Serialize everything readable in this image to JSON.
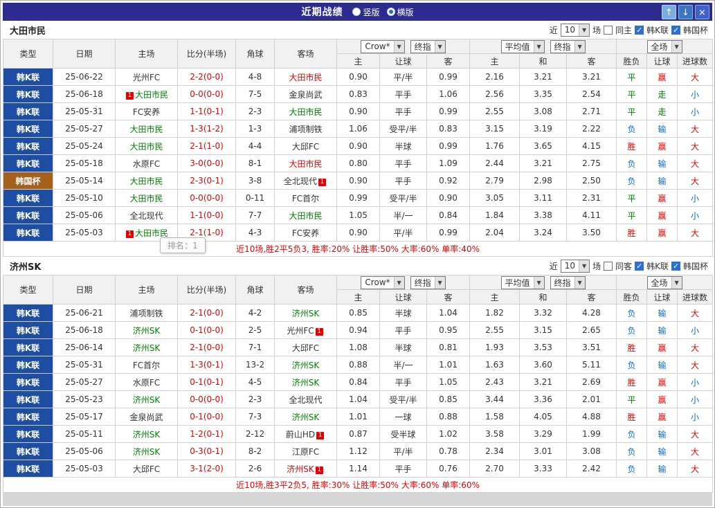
{
  "titlebar": {
    "title": "近期战绩",
    "radios": [
      {
        "label": "竖版",
        "selected": false
      },
      {
        "label": "横版",
        "selected": true
      }
    ],
    "buttons": {
      "up": "↑",
      "down": "↓",
      "close": "×"
    }
  },
  "tooltip": "排名：1",
  "tables": [
    {
      "team": "大田市民",
      "filter": {
        "near": "近",
        "count": "10",
        "games": "场",
        "same": "同主",
        "same_checked": false,
        "league": "韩K联",
        "league_checked": true,
        "cup": "韩国杯",
        "cup_checked": true
      },
      "selects": {
        "book": "Crow*",
        "book_final": "终指",
        "avg": "平均值",
        "avg_final": "终指",
        "scope": "全场"
      },
      "columns": [
        "类型",
        "日期",
        "主场",
        "比分(半场)",
        "角球",
        "客场",
        "主",
        "让球",
        "客",
        "主",
        "和",
        "客",
        "胜负",
        "让球",
        "进球数"
      ],
      "rows": [
        {
          "type": "韩K联",
          "cup": false,
          "date": "25-06-22",
          "home": "光州FC",
          "home_color": "black",
          "home_badge": "",
          "score": "2-2(0-0)",
          "corner": "4-8",
          "away": "大田市民",
          "away_color": "red",
          "away_badge": "",
          "o1": "0.90",
          "hcap": "平/半",
          "o3": "0.99",
          "a1": "2.16",
          "a2": "3.21",
          "a3": "3.21",
          "wl": "平",
          "wlc": "green",
          "hr": "赢",
          "hrc": "red",
          "ou": "大",
          "ouc": "red"
        },
        {
          "type": "韩K联",
          "cup": false,
          "date": "25-06-18",
          "home": "大田市民",
          "home_color": "green",
          "home_badge": "1",
          "score": "0-0(0-0)",
          "corner": "7-5",
          "away": "金泉尚武",
          "away_color": "black",
          "away_badge": "",
          "o1": "0.83",
          "hcap": "平手",
          "o3": "1.06",
          "a1": "2.56",
          "a2": "3.35",
          "a3": "2.54",
          "wl": "平",
          "wlc": "green",
          "hr": "走",
          "hrc": "green",
          "ou": "小",
          "ouc": "blue"
        },
        {
          "type": "韩K联",
          "cup": false,
          "date": "25-05-31",
          "home": "FC安养",
          "home_color": "black",
          "home_badge": "",
          "score": "1-1(0-1)",
          "corner": "2-3",
          "away": "大田市民",
          "away_color": "green",
          "away_badge": "",
          "o1": "0.90",
          "hcap": "平手",
          "o3": "0.99",
          "a1": "2.55",
          "a2": "3.08",
          "a3": "2.71",
          "wl": "平",
          "wlc": "green",
          "hr": "走",
          "hrc": "green",
          "ou": "小",
          "ouc": "blue"
        },
        {
          "type": "韩K联",
          "cup": false,
          "date": "25-05-27",
          "home": "大田市民",
          "home_color": "green",
          "home_badge": "",
          "score": "1-3(1-2)",
          "corner": "1-3",
          "away": "浦项制铁",
          "away_color": "black",
          "away_badge": "",
          "o1": "1.06",
          "hcap": "受平/半",
          "o3": "0.83",
          "a1": "3.15",
          "a2": "3.19",
          "a3": "2.22",
          "wl": "负",
          "wlc": "blue",
          "hr": "输",
          "hrc": "blue",
          "ou": "大",
          "ouc": "red"
        },
        {
          "type": "韩K联",
          "cup": false,
          "date": "25-05-24",
          "home": "大田市民",
          "home_color": "green",
          "home_badge": "",
          "score": "2-1(1-0)",
          "corner": "4-4",
          "away": "大邱FC",
          "away_color": "black",
          "away_badge": "",
          "o1": "0.90",
          "hcap": "半球",
          "o3": "0.99",
          "a1": "1.76",
          "a2": "3.65",
          "a3": "4.15",
          "wl": "胜",
          "wlc": "red",
          "hr": "赢",
          "hrc": "red",
          "ou": "大",
          "ouc": "red"
        },
        {
          "type": "韩K联",
          "cup": false,
          "date": "25-05-18",
          "home": "水原FC",
          "home_color": "black",
          "home_badge": "",
          "score": "3-0(0-0)",
          "corner": "8-1",
          "away": "大田市民",
          "away_color": "red",
          "away_badge": "",
          "o1": "0.80",
          "hcap": "平手",
          "o3": "1.09",
          "a1": "2.44",
          "a2": "3.21",
          "a3": "2.75",
          "wl": "负",
          "wlc": "blue",
          "hr": "输",
          "hrc": "blue",
          "ou": "大",
          "ouc": "red"
        },
        {
          "type": "韩国杯",
          "cup": true,
          "date": "25-05-14",
          "home": "大田市民",
          "home_color": "green",
          "home_badge": "",
          "score": "2-3(0-1)",
          "corner": "3-8",
          "away": "全北现代",
          "away_color": "black",
          "away_badge": "1",
          "o1": "0.90",
          "hcap": "平手",
          "o3": "0.92",
          "a1": "2.79",
          "a2": "2.98",
          "a3": "2.50",
          "wl": "负",
          "wlc": "blue",
          "hr": "输",
          "hrc": "blue",
          "ou": "大",
          "ouc": "red"
        },
        {
          "type": "韩K联",
          "cup": false,
          "date": "25-05-10",
          "home": "大田市民",
          "home_color": "green",
          "home_badge": "",
          "score": "0-0(0-0)",
          "corner": "0-11",
          "away": "FC首尔",
          "away_color": "black",
          "away_badge": "",
          "o1": "0.99",
          "hcap": "受平/半",
          "o3": "0.90",
          "a1": "3.05",
          "a2": "3.11",
          "a3": "2.31",
          "wl": "平",
          "wlc": "green",
          "hr": "赢",
          "hrc": "red",
          "ou": "小",
          "ouc": "blue"
        },
        {
          "type": "韩K联",
          "cup": false,
          "date": "25-05-06",
          "home": "全北现代",
          "home_color": "black",
          "home_badge": "",
          "score": "1-1(0-0)",
          "corner": "7-7",
          "away": "大田市民",
          "away_color": "green",
          "away_badge": "",
          "o1": "1.05",
          "hcap": "半/一",
          "o3": "0.84",
          "a1": "1.84",
          "a2": "3.38",
          "a3": "4.11",
          "wl": "平",
          "wlc": "green",
          "hr": "赢",
          "hrc": "red",
          "ou": "小",
          "ouc": "blue"
        },
        {
          "type": "韩K联",
          "cup": false,
          "date": "25-05-03",
          "home": "大田市民",
          "home_color": "green",
          "home_badge": "1",
          "score": "2-1(1-0)",
          "corner": "4-3",
          "away": "FC安养",
          "away_color": "black",
          "away_badge": "",
          "o1": "0.90",
          "hcap": "平/半",
          "o3": "0.99",
          "a1": "2.04",
          "a2": "3.24",
          "a3": "3.50",
          "wl": "胜",
          "wlc": "red",
          "hr": "赢",
          "hrc": "red",
          "ou": "大",
          "ouc": "red"
        }
      ],
      "summary": "近10场,胜2平5负3, 胜率:20% 让胜率:50% 大率:60% 单率:40%"
    },
    {
      "team": "济州SK",
      "filter": {
        "near": "近",
        "count": "10",
        "games": "场",
        "same": "同客",
        "same_checked": false,
        "league": "韩K联",
        "league_checked": true,
        "cup": "韩国杯",
        "cup_checked": true
      },
      "selects": {
        "book": "Crow*",
        "book_final": "终指",
        "avg": "平均值",
        "avg_final": "终指",
        "scope": "全场"
      },
      "columns": [
        "类型",
        "日期",
        "主场",
        "比分(半场)",
        "角球",
        "客场",
        "主",
        "让球",
        "客",
        "主",
        "和",
        "客",
        "胜负",
        "让球",
        "进球数"
      ],
      "rows": [
        {
          "type": "韩K联",
          "cup": false,
          "date": "25-06-21",
          "home": "浦项制铁",
          "home_color": "black",
          "home_badge": "",
          "score": "2-1(0-0)",
          "corner": "4-2",
          "away": "济州SK",
          "away_color": "green",
          "away_badge": "",
          "o1": "0.85",
          "hcap": "半球",
          "o3": "1.04",
          "a1": "1.82",
          "a2": "3.32",
          "a3": "4.28",
          "wl": "负",
          "wlc": "blue",
          "hr": "输",
          "hrc": "blue",
          "ou": "大",
          "ouc": "red"
        },
        {
          "type": "韩K联",
          "cup": false,
          "date": "25-06-18",
          "home": "济州SK",
          "home_color": "green",
          "home_badge": "",
          "score": "0-1(0-0)",
          "corner": "2-5",
          "away": "光州FC",
          "away_color": "black",
          "away_badge": "1",
          "o1": "0.94",
          "hcap": "平手",
          "o3": "0.95",
          "a1": "2.55",
          "a2": "3.15",
          "a3": "2.65",
          "wl": "负",
          "wlc": "blue",
          "hr": "输",
          "hrc": "blue",
          "ou": "小",
          "ouc": "blue"
        },
        {
          "type": "韩K联",
          "cup": false,
          "date": "25-06-14",
          "home": "济州SK",
          "home_color": "green",
          "home_badge": "",
          "score": "2-1(0-0)",
          "corner": "7-1",
          "away": "大邱FC",
          "away_color": "black",
          "away_badge": "",
          "o1": "1.08",
          "hcap": "半球",
          "o3": "0.81",
          "a1": "1.93",
          "a2": "3.53",
          "a3": "3.51",
          "wl": "胜",
          "wlc": "red",
          "hr": "赢",
          "hrc": "red",
          "ou": "大",
          "ouc": "red"
        },
        {
          "type": "韩K联",
          "cup": false,
          "date": "25-05-31",
          "home": "FC首尔",
          "home_color": "black",
          "home_badge": "",
          "score": "1-3(0-1)",
          "corner": "13-2",
          "away": "济州SK",
          "away_color": "green",
          "away_badge": "",
          "o1": "0.88",
          "hcap": "半/一",
          "o3": "1.01",
          "a1": "1.63",
          "a2": "3.60",
          "a3": "5.11",
          "wl": "负",
          "wlc": "blue",
          "hr": "输",
          "hrc": "blue",
          "ou": "大",
          "ouc": "red"
        },
        {
          "type": "韩K联",
          "cup": false,
          "date": "25-05-27",
          "home": "水原FC",
          "home_color": "black",
          "home_badge": "",
          "score": "0-1(0-1)",
          "corner": "4-5",
          "away": "济州SK",
          "away_color": "green",
          "away_badge": "",
          "o1": "0.84",
          "hcap": "平手",
          "o3": "1.05",
          "a1": "2.43",
          "a2": "3.21",
          "a3": "2.69",
          "wl": "胜",
          "wlc": "red",
          "hr": "赢",
          "hrc": "red",
          "ou": "小",
          "ouc": "blue"
        },
        {
          "type": "韩K联",
          "cup": false,
          "date": "25-05-23",
          "home": "济州SK",
          "home_color": "green",
          "home_badge": "",
          "score": "0-0(0-0)",
          "corner": "2-3",
          "away": "全北现代",
          "away_color": "black",
          "away_badge": "",
          "o1": "1.04",
          "hcap": "受平/半",
          "o3": "0.85",
          "a1": "3.44",
          "a2": "3.36",
          "a3": "2.01",
          "wl": "平",
          "wlc": "green",
          "hr": "赢",
          "hrc": "red",
          "ou": "小",
          "ouc": "blue"
        },
        {
          "type": "韩K联",
          "cup": false,
          "date": "25-05-17",
          "home": "金泉尚武",
          "home_color": "black",
          "home_badge": "",
          "score": "0-1(0-0)",
          "corner": "7-3",
          "away": "济州SK",
          "away_color": "green",
          "away_badge": "",
          "o1": "1.01",
          "hcap": "一球",
          "o3": "0.88",
          "a1": "1.58",
          "a2": "4.05",
          "a3": "4.88",
          "wl": "胜",
          "wlc": "red",
          "hr": "赢",
          "hrc": "red",
          "ou": "小",
          "ouc": "blue"
        },
        {
          "type": "韩K联",
          "cup": false,
          "date": "25-05-11",
          "home": "济州SK",
          "home_color": "green",
          "home_badge": "",
          "score": "1-2(0-1)",
          "corner": "2-12",
          "away": "蔚山HD",
          "away_color": "black",
          "away_badge": "1",
          "o1": "0.87",
          "hcap": "受半球",
          "o3": "1.02",
          "a1": "3.58",
          "a2": "3.29",
          "a3": "1.99",
          "wl": "负",
          "wlc": "blue",
          "hr": "输",
          "hrc": "blue",
          "ou": "大",
          "ouc": "red"
        },
        {
          "type": "韩K联",
          "cup": false,
          "date": "25-05-06",
          "home": "济州SK",
          "home_color": "green",
          "home_badge": "",
          "score": "0-3(0-1)",
          "corner": "8-2",
          "away": "江原FC",
          "away_color": "black",
          "away_badge": "",
          "o1": "1.12",
          "hcap": "平/半",
          "o3": "0.78",
          "a1": "2.34",
          "a2": "3.01",
          "a3": "3.08",
          "wl": "负",
          "wlc": "blue",
          "hr": "输",
          "hrc": "blue",
          "ou": "大",
          "ouc": "red"
        },
        {
          "type": "韩K联",
          "cup": false,
          "date": "25-05-03",
          "home": "大邱FC",
          "home_color": "black",
          "home_badge": "",
          "score": "3-1(2-0)",
          "corner": "2-6",
          "away": "济州SK",
          "away_color": "red",
          "away_badge": "1",
          "o1": "1.14",
          "hcap": "平手",
          "o3": "0.76",
          "a1": "2.70",
          "a2": "3.33",
          "a3": "2.42",
          "wl": "负",
          "wlc": "blue",
          "hr": "输",
          "hrc": "blue",
          "ou": "大",
          "ouc": "red"
        }
      ],
      "summary": "近10场,胜3平2负5, 胜率:30% 让胜率:50% 大率:60% 单率:60%"
    }
  ]
}
